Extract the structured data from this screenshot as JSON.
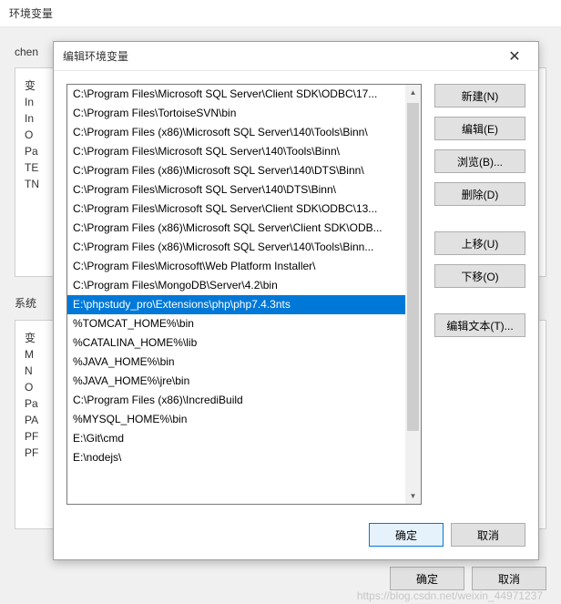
{
  "parent": {
    "title": "环境变量",
    "group1_label": "chen",
    "group2_label": "系统",
    "bg_rows1": [
      "变",
      "In",
      "In",
      "O",
      "Pa",
      "TE",
      "TN"
    ],
    "bg_rows2": [
      "变",
      "M",
      "N",
      "O",
      "Pa",
      "PA",
      "PF",
      "PF"
    ],
    "buttons": {
      "ok": "确定",
      "cancel": "取消"
    }
  },
  "dialog": {
    "title": "编辑环境变量",
    "close_aria": "Close",
    "items": [
      "C:\\Program Files\\Microsoft SQL Server\\Client SDK\\ODBC\\17...",
      "C:\\Program Files\\TortoiseSVN\\bin",
      "C:\\Program Files (x86)\\Microsoft SQL Server\\140\\Tools\\Binn\\",
      "C:\\Program Files\\Microsoft SQL Server\\140\\Tools\\Binn\\",
      "C:\\Program Files (x86)\\Microsoft SQL Server\\140\\DTS\\Binn\\",
      "C:\\Program Files\\Microsoft SQL Server\\140\\DTS\\Binn\\",
      "C:\\Program Files\\Microsoft SQL Server\\Client SDK\\ODBC\\13...",
      "C:\\Program Files (x86)\\Microsoft SQL Server\\Client SDK\\ODB...",
      "C:\\Program Files (x86)\\Microsoft SQL Server\\140\\Tools\\Binn...",
      "C:\\Program Files\\Microsoft\\Web Platform Installer\\",
      "C:\\Program Files\\MongoDB\\Server\\4.2\\bin",
      "E:\\phpstudy_pro\\Extensions\\php\\php7.4.3nts",
      "%TOMCAT_HOME%\\bin",
      "%CATALINA_HOME%\\lib",
      "%JAVA_HOME%\\bin",
      "%JAVA_HOME%\\jre\\bin",
      "C:\\Program Files (x86)\\IncrediBuild",
      "%MYSQL_HOME%\\bin",
      "E:\\Git\\cmd",
      "E:\\nodejs\\"
    ],
    "selected_index": 11,
    "buttons": {
      "new": "新建(N)",
      "edit": "编辑(E)",
      "browse": "浏览(B)...",
      "delete": "删除(D)",
      "move_up": "上移(U)",
      "move_down": "下移(O)",
      "edit_text": "编辑文本(T)...",
      "ok": "确定",
      "cancel": "取消"
    }
  },
  "watermark": "https://blog.csdn.net/weixin_44971237"
}
